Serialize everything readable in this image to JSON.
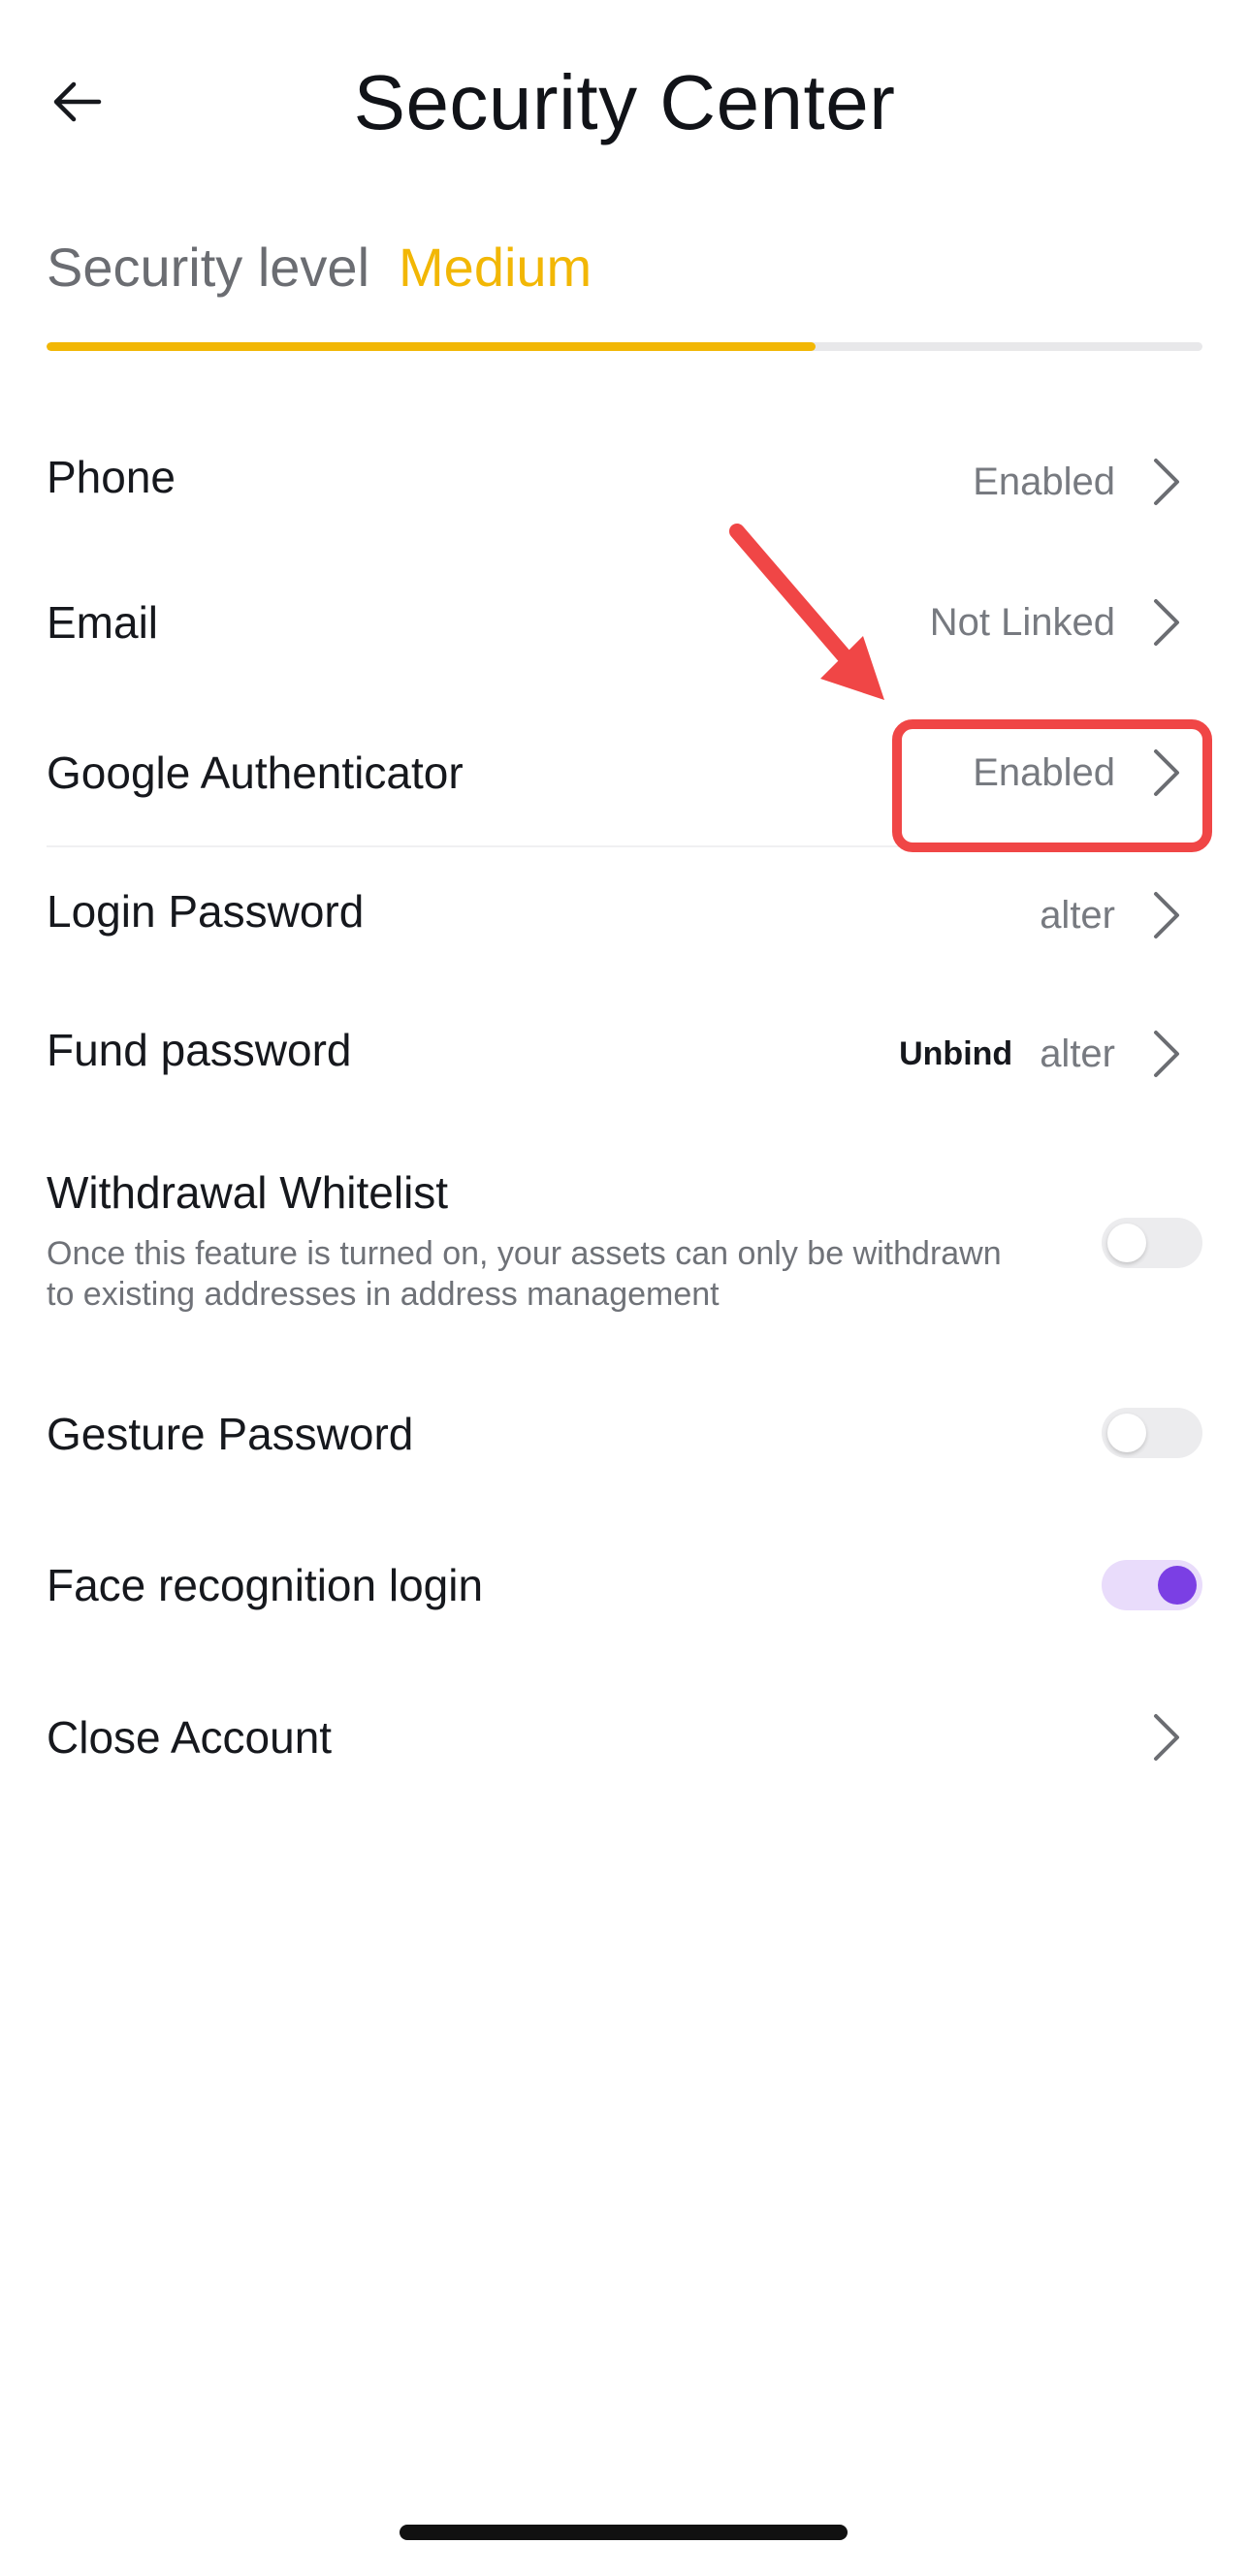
{
  "header": {
    "title": "Security Center",
    "back_icon": "arrow-left-icon"
  },
  "security_level": {
    "label": "Security level",
    "value": "Medium",
    "progress_fraction": 0.665,
    "accent_color": "#f2b705"
  },
  "rows": {
    "phone": {
      "label": "Phone",
      "status": "Enabled"
    },
    "email": {
      "label": "Email",
      "status": "Not Linked"
    },
    "google_auth": {
      "label": "Google Authenticator",
      "status": "Enabled"
    },
    "login_password": {
      "label": "Login Password",
      "status": "alter"
    },
    "fund_password": {
      "label": "Fund password",
      "extra": "Unbind",
      "status": "alter"
    },
    "withdrawal_whitelist": {
      "label": "Withdrawal Whitelist",
      "description": "Once this feature is turned on, your assets can only be withdrawn to existing addresses in address management",
      "enabled": false
    },
    "gesture_password": {
      "label": "Gesture Password",
      "enabled": false
    },
    "face_login": {
      "label": "Face recognition login",
      "enabled": true,
      "accent_color": "#7b3fe4"
    },
    "close_account": {
      "label": "Close Account"
    }
  },
  "annotation": {
    "color": "#f04646"
  }
}
